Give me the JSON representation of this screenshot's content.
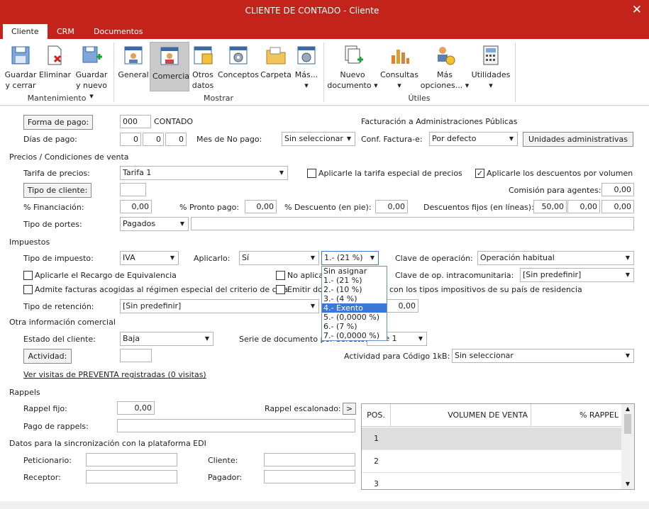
{
  "window": {
    "title": "CLIENTE DE CONTADO - Cliente"
  },
  "tabs": [
    "Cliente",
    "CRM",
    "Documentos"
  ],
  "ribbon": {
    "mantenimiento": {
      "label": "Mantenimiento",
      "buttons": [
        "Guardar\ny cerrar",
        "Eliminar",
        "Guardar\ny nuevo ▾"
      ]
    },
    "mostrar": {
      "label": "Mostrar",
      "buttons": [
        "General",
        "Comercial",
        "Otros\ndatos",
        "Conceptos",
        "Carpeta",
        "Más...\n▾"
      ]
    },
    "utiles": {
      "label": "Útiles",
      "buttons": [
        "Nuevo\ndocumento ▾",
        "Consultas\n▾",
        "Más\nopciones... ▾",
        "Utilidades\n▾"
      ]
    }
  },
  "form": {
    "forma_pago_btn": "Forma de pago:",
    "forma_pago_code": "000",
    "forma_pago_name": "CONTADO",
    "facturacion_title": "Facturación a Administraciones Públicas",
    "dias_pago_label": "Días de pago:",
    "dias": [
      "0",
      "0",
      "0"
    ],
    "mes_no_pago_label": "Mes de No pago:",
    "mes_no_pago": "Sin seleccionar",
    "conf_factura_label": "Conf. Factura-e:",
    "conf_factura": "Por defecto",
    "unidades_btn": "Unidades administrativas",
    "precios_title": "Precios / Condiciones de venta",
    "tarifa_label": "Tarifa de precios:",
    "tarifa": "Tarifa 1",
    "aplicar_tarifa_label": "Aplicarle la tarifa especial de precios",
    "aplicar_desc_label": "Aplicarle los descuentos por volumen",
    "tipo_cliente_btn": "Tipo de cliente:",
    "comision_label": "Comisión para agentes:",
    "comision": "0,00",
    "financiacion_label": "% Financiación:",
    "financiacion": "0,00",
    "pronto_pago_label": "% Pronto pago:",
    "pronto_pago": "0,00",
    "descuento_pie_label": "% Descuento (en pie):",
    "descuento_pie": "0,00",
    "desc_fijos_label": "Descuentos fijos (en líneas):",
    "desc_fijos": [
      "50,00",
      "0,00",
      "0,00"
    ],
    "portes_label": "Tipo de portes:",
    "portes": "Pagados",
    "impuestos_title": "Impuestos",
    "tipo_impuesto_label": "Tipo de impuesto:",
    "tipo_impuesto": "IVA",
    "aplicarlo_label": "Aplicarlo:",
    "aplicarlo": "Sí",
    "iva_tipo": "1.- (21 %)",
    "clave_op_label": "Clave de operación:",
    "clave_op": "Operación habitual",
    "recargo_label": "Aplicarle el Recargo de Equivalencia",
    "no_aplica_label": "No aplica",
    "clave_intra_label": "Clave de op. intracomunitaria:",
    "clave_intra": "[Sin predefinir]",
    "admite_label": "Admite facturas acogidas al régimen especial del criterio de caja",
    "emitir_label": "Emitir do",
    "emitir_tail": "con los tipos impositivos de su país de residencia",
    "retencion_label": "Tipo de retención:",
    "retencion": "[Sin predefinir]",
    "retencion_pct": "0,00",
    "otra_title": "Otra información comercial",
    "estado_label": "Estado del cliente:",
    "estado": "Baja",
    "serie_label": "Serie de documento por defecto:",
    "serie": "Serie 1",
    "actividad_btn": "Actividad:",
    "actividad_1kb_label": "Actividad para Código 1kB:",
    "actividad_1kb": "Sin seleccionar",
    "visitas_link": "Ver visitas de PREVENTA registradas (0 visitas)",
    "rappels_title": "Rappels",
    "rappel_fijo_label": "Rappel fijo:",
    "rappel_fijo": "0,00",
    "rappel_esc_label": "Rappel escalonado:",
    "rappel_esc_btn": ">",
    "pago_rappels_label": "Pago de rappels:",
    "edi_title": "Datos para la sincronización con la plataforma EDI",
    "peticionario_label": "Peticionario:",
    "cliente_label": "Cliente:",
    "receptor_label": "Receptor:",
    "pagador_label": "Pagador:"
  },
  "dropdown": {
    "items": [
      "Sin asignar",
      "1.- (21 %)",
      "2.- (10 %)",
      "3.- (4 %)",
      "4.- Exento",
      "5.- (0,0000 %)",
      "6.- (7 %)",
      "7.- (0,0000 %)"
    ],
    "highlighted": "4.- Exento"
  },
  "grid": {
    "headers": [
      "POS.",
      "VOLUMEN DE VENTA",
      "% RAPPEL"
    ],
    "rows": [
      "1",
      "2",
      "3"
    ]
  }
}
